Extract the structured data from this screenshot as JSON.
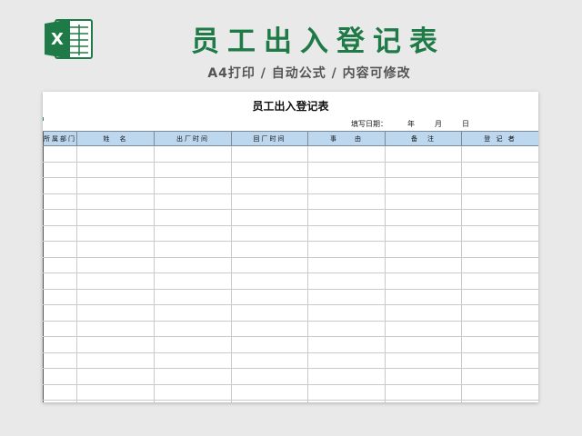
{
  "banner": {
    "title": "员工出入登记表",
    "subtitle": "A4打印 / 自动公式 / 内容可修改"
  },
  "logo": {
    "icon": "excel-icon",
    "letter": "X",
    "color": "#1e7a46"
  },
  "sheet": {
    "title": "员工出入登记表",
    "fill_date_label": "填写日期：",
    "year_label": "年",
    "month_label": "月",
    "day_label": "日",
    "columns": [
      "所属部门",
      "姓　名",
      "出厂时间",
      "回厂时间",
      "事　　由",
      "备　注",
      "登 记 者"
    ],
    "row_count": 17
  },
  "colors": {
    "header_bg": "#bdd7ee",
    "accent": "#1e7a46"
  }
}
